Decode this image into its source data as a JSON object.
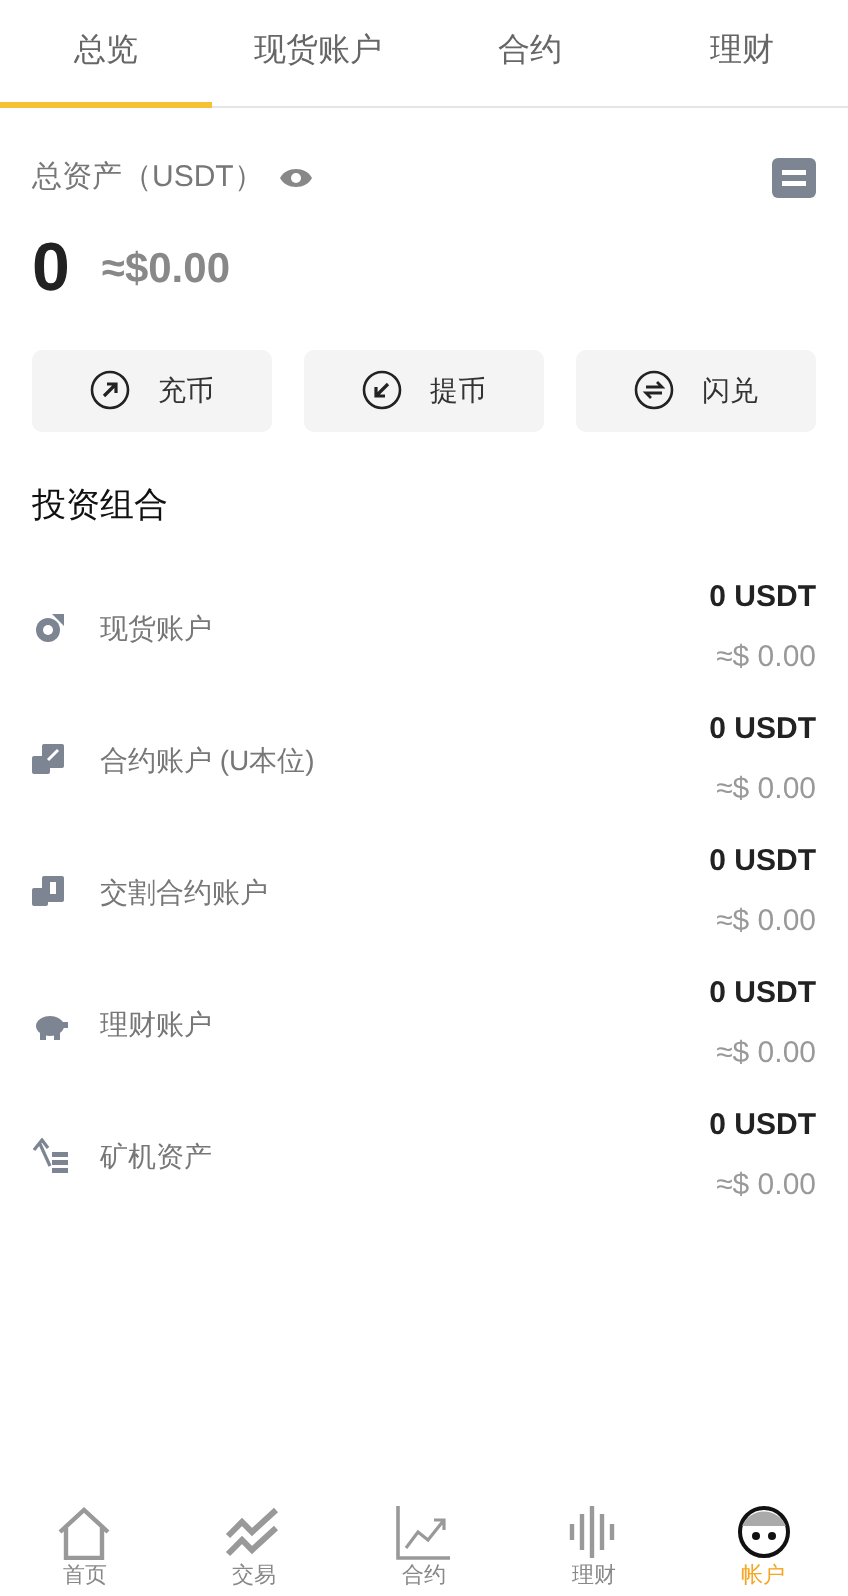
{
  "tabs": [
    {
      "label": "总览",
      "selected": true
    },
    {
      "label": "现货账户",
      "selected": false
    },
    {
      "label": "合约",
      "selected": false
    },
    {
      "label": "理财",
      "selected": false
    }
  ],
  "summary": {
    "label": "总资产（USDT）",
    "amount": "0",
    "approx": "≈$0.00"
  },
  "actions": [
    {
      "kind": "deposit",
      "label": "充币"
    },
    {
      "kind": "withdraw",
      "label": "提币"
    },
    {
      "kind": "swap",
      "label": "闪兑"
    }
  ],
  "section_title": "投资组合",
  "accounts": [
    {
      "kind": "spot",
      "name": "现货账户",
      "amount": "0 USDT",
      "approx": "≈$ 0.00"
    },
    {
      "kind": "futures",
      "name": "合约账户 (U本位)",
      "amount": "0 USDT",
      "approx": "≈$ 0.00"
    },
    {
      "kind": "delivery",
      "name": "交割合约账户",
      "amount": "0 USDT",
      "approx": "≈$ 0.00"
    },
    {
      "kind": "earn",
      "name": "理财账户",
      "amount": "0 USDT",
      "approx": "≈$ 0.00"
    },
    {
      "kind": "mining",
      "name": "矿机资产",
      "amount": "0 USDT",
      "approx": "≈$ 0.00"
    }
  ],
  "bottom_nav": [
    {
      "kind": "home",
      "label": "首页",
      "selected": false
    },
    {
      "kind": "trade",
      "label": "交易",
      "selected": false
    },
    {
      "kind": "contract",
      "label": "合约",
      "selected": false
    },
    {
      "kind": "finance",
      "label": "理财",
      "selected": false
    },
    {
      "kind": "account",
      "label": "帐户",
      "selected": true
    }
  ]
}
